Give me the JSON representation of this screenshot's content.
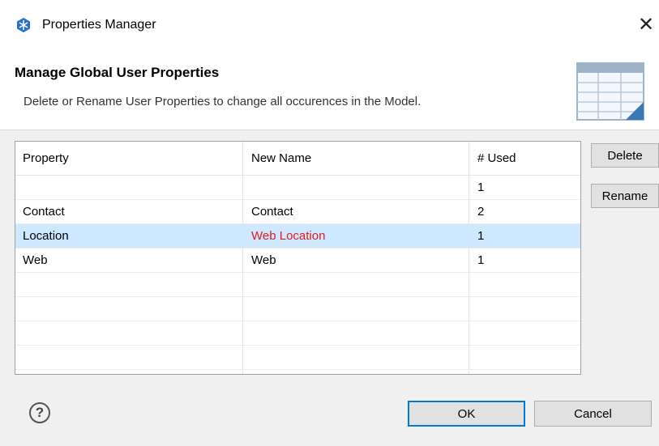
{
  "window": {
    "title": "Properties Manager",
    "close_glyph": "✕"
  },
  "banner": {
    "title": "Manage Global User Properties",
    "description": "Delete or Rename User Properties to change all occurences in the Model."
  },
  "table": {
    "columns": [
      "Property",
      "New Name",
      "# Used"
    ],
    "rows": [
      {
        "property": "",
        "new_name": "",
        "used": "1"
      },
      {
        "property": "Contact",
        "new_name": "Contact",
        "used": "2"
      },
      {
        "property": "Location",
        "new_name": "Web Location",
        "used": "1"
      },
      {
        "property": "Web",
        "new_name": "Web",
        "used": "1"
      }
    ],
    "selected_row": 2,
    "renamed_color": "#e21b1b",
    "selection_color": "#cde8ff"
  },
  "side_buttons": {
    "delete": "Delete",
    "rename": "Rename"
  },
  "footer": {
    "help_glyph": "?",
    "ok": "OK",
    "cancel": "Cancel"
  },
  "icons": {
    "app": "snowflake-icon",
    "banner": "table-icon",
    "help": "help-circle-icon",
    "close": "close-icon"
  }
}
